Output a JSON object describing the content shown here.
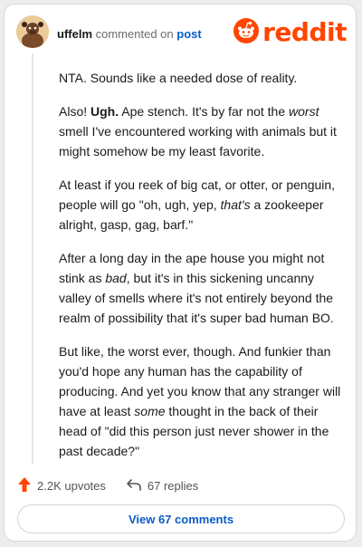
{
  "header": {
    "username": "uffelm",
    "commented_on": "commented on",
    "post_link": "post",
    "logo_text": "reddit"
  },
  "comment": {
    "p1": "NTA. Sounds like a needed dose of reality.",
    "p2": {
      "a": "Also! ",
      "b_bold": "Ugh.",
      "c": " Ape stench. It's by far not the ",
      "d_italic": "worst",
      "e": " smell I've encountered working with animals but it might somehow be my least favorite."
    },
    "p3": {
      "a": "At least if you reek of big cat, or otter, or penguin, people will go \"oh, ugh, yep, ",
      "b_italic": "that's",
      "c": " a zookeeper alright, gasp, gag, barf.\""
    },
    "p4": {
      "a": "After a long day in the ape house you might not stink as ",
      "b_italic": "bad",
      "c": ", but it's in this sickening uncanny valley of smells where it's not entirely beyond the realm of possibility that it's super bad human BO."
    },
    "p5": {
      "a": "But like, the worst ever, though. And funkier than you'd hope any human has the capability of producing. And yet you know that any stranger will have at least ",
      "b_italic": "some",
      "c": " thought in the back of their head of \"did this person just never shower in the past decade?\""
    }
  },
  "actions": {
    "upvotes": "2.2K upvotes",
    "replies": "67 replies"
  },
  "view_button": "View 67 comments",
  "colors": {
    "brand": "#ff4500",
    "link": "#0b5cc7"
  },
  "icons": [
    "avatar",
    "reddit-logo-icon",
    "upvote-icon",
    "reply-icon"
  ]
}
